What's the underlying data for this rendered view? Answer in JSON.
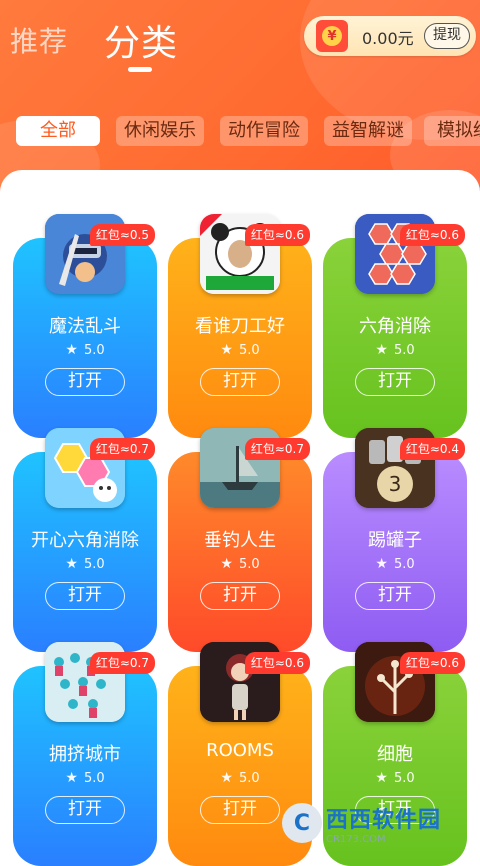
{
  "header": {
    "tabs": [
      {
        "label": "推荐",
        "active": false
      },
      {
        "label": "分类",
        "active": true
      }
    ],
    "wallet": {
      "icon": "red-envelope-coin-icon",
      "coin_symbol": "¥",
      "amount": "0.00元",
      "withdraw_label": "提现"
    }
  },
  "categories": [
    {
      "label": "全部",
      "active": true
    },
    {
      "label": "休闲娱乐",
      "active": false
    },
    {
      "label": "动作冒险",
      "active": false
    },
    {
      "label": "益智解谜",
      "active": false
    },
    {
      "label": "模拟经",
      "active": false
    }
  ],
  "games": [
    {
      "name": "魔法乱斗",
      "badge": "红包≈0.5",
      "rating": "5.0",
      "button": "打开",
      "color": "blue",
      "icon": "knight-hero-icon"
    },
    {
      "name": "看谁刀工好",
      "badge": "红包≈0.6",
      "rating": "5.0",
      "button": "打开",
      "color": "orange",
      "icon": "panda-meme-icon"
    },
    {
      "name": "六角消除",
      "badge": "红包≈0.6",
      "rating": "5.0",
      "button": "打开",
      "color": "green",
      "icon": "hexagon-puzzle-icon"
    },
    {
      "name": "开心六角消除",
      "badge": "红包≈0.7",
      "rating": "5.0",
      "button": "打开",
      "color": "blue",
      "icon": "happy-hexagon-icon"
    },
    {
      "name": "垂钓人生",
      "badge": "红包≈0.7",
      "rating": "5.0",
      "button": "打开",
      "color": "red",
      "icon": "fishing-boat-icon"
    },
    {
      "name": "踢罐子",
      "badge": "红包≈0.4",
      "rating": "5.0",
      "button": "打开",
      "color": "purple",
      "icon": "cans-ball-icon"
    },
    {
      "name": "拥挤城市",
      "badge": "红包≈0.7",
      "rating": "5.0",
      "button": "打开",
      "color": "blue",
      "icon": "crowd-city-icon"
    },
    {
      "name": "ROOMS",
      "badge": "红包≈0.6",
      "rating": "5.0",
      "button": "打开",
      "color": "orange",
      "icon": "rooms-girl-icon"
    },
    {
      "name": "细胞",
      "badge": "红包≈0.6",
      "rating": "5.0",
      "button": "打开",
      "color": "green",
      "icon": "cell-tree-icon"
    }
  ],
  "watermark": {
    "logo": "C",
    "title": "西西软件园",
    "subtitle": "CR173.COM"
  }
}
